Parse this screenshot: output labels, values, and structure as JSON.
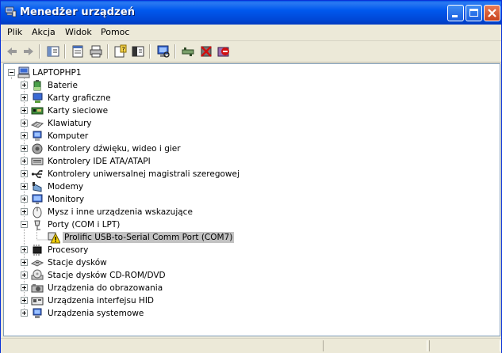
{
  "window": {
    "title": "Menedżer urządzeń"
  },
  "menu": [
    {
      "label": "Plik"
    },
    {
      "label": "Akcja"
    },
    {
      "label": "Widok"
    },
    {
      "label": "Pomoc"
    }
  ],
  "toolbar": [
    "back-icon",
    "forward-icon",
    "up-icon",
    "properties-icon",
    "print-icon",
    "help-icon",
    "show-hide-console-tree-icon",
    "scan-hardware-icon",
    "update-driver-icon",
    "disable-device-icon",
    "uninstall-device-icon"
  ],
  "tree": {
    "root": "LAPTOPHP1",
    "categories": [
      {
        "label": "Baterie",
        "icon": "battery-icon",
        "expanded": false
      },
      {
        "label": "Karty graficzne",
        "icon": "display-adapter-icon",
        "expanded": false
      },
      {
        "label": "Karty sieciowe",
        "icon": "network-card-icon",
        "expanded": false
      },
      {
        "label": "Klawiatury",
        "icon": "keyboard-icon",
        "expanded": false
      },
      {
        "label": "Komputer",
        "icon": "computer-icon",
        "expanded": false
      },
      {
        "label": "Kontrolery dźwięku, wideo i gier",
        "icon": "sound-icon",
        "expanded": false
      },
      {
        "label": "Kontrolery IDE ATA/ATAPI",
        "icon": "ide-controller-icon",
        "expanded": false
      },
      {
        "label": "Kontrolery uniwersalnej magistrali szeregowej",
        "icon": "usb-icon",
        "expanded": false
      },
      {
        "label": "Modemy",
        "icon": "modem-icon",
        "expanded": false
      },
      {
        "label": "Monitory",
        "icon": "monitor-icon",
        "expanded": false
      },
      {
        "label": "Mysz i inne urządzenia wskazujące",
        "icon": "mouse-icon",
        "expanded": false
      },
      {
        "label": "Porty (COM i LPT)",
        "icon": "port-icon",
        "expanded": true,
        "children": [
          {
            "label": "Prolific USB-to-Serial Comm Port (COM7)",
            "icon": "warning-device-icon",
            "selected": true
          }
        ]
      },
      {
        "label": "Procesory",
        "icon": "processor-icon",
        "expanded": false
      },
      {
        "label": "Stacje dysków",
        "icon": "disk-drive-icon",
        "expanded": false
      },
      {
        "label": "Stacje dysków CD-ROM/DVD",
        "icon": "cdrom-icon",
        "expanded": false
      },
      {
        "label": "Urządzenia do obrazowania",
        "icon": "imaging-icon",
        "expanded": false
      },
      {
        "label": "Urządzenia interfejsu HID",
        "icon": "hid-icon",
        "expanded": false
      },
      {
        "label": "Urządzenia systemowe",
        "icon": "system-device-icon",
        "expanded": false
      }
    ]
  },
  "colors": {
    "titlebar": "#0058ee",
    "selection": "#c2c2c2",
    "warning": "#f5d20a"
  }
}
